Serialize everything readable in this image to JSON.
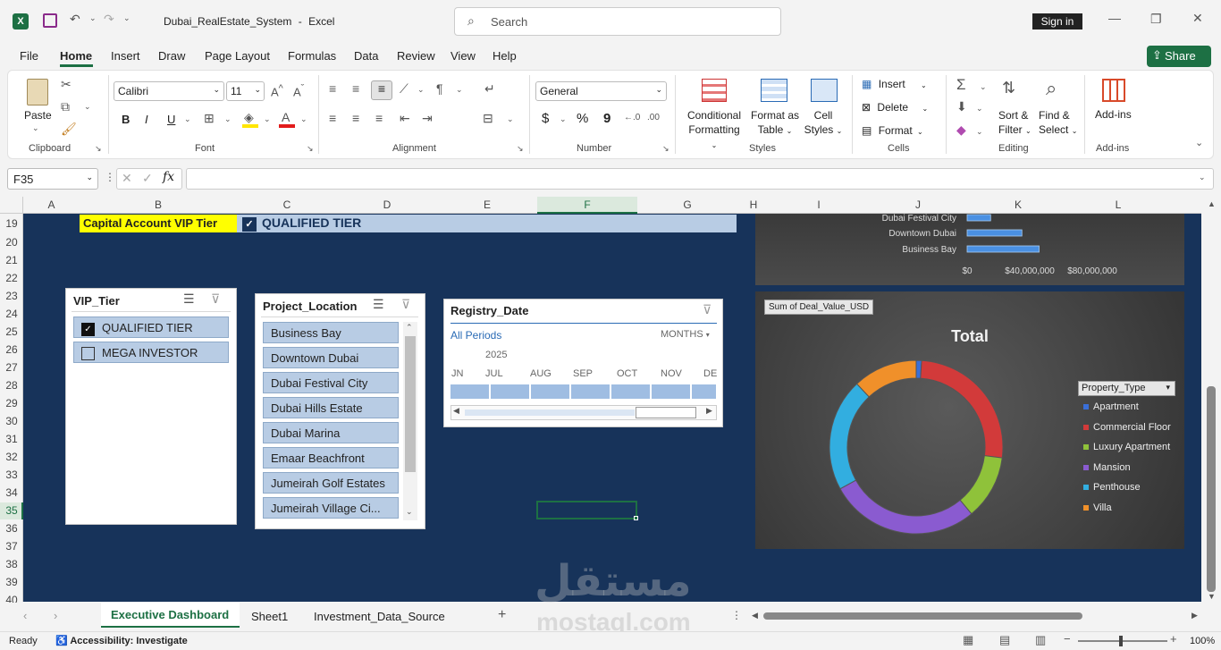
{
  "window": {
    "file_title": "Dubai_RealEstate_System",
    "app_name": "Excel",
    "title_sep": "-",
    "search_placeholder": "Search",
    "sign_in": "Sign in",
    "share": "Share"
  },
  "ribbon_tabs": [
    "File",
    "Home",
    "Insert",
    "Draw",
    "Page Layout",
    "Formulas",
    "Data",
    "Review",
    "View",
    "Help"
  ],
  "ribbon": {
    "clipboard": {
      "paste": "Paste",
      "label": "Clipboard"
    },
    "font": {
      "name": "Calibri",
      "size": "11",
      "label": "Font",
      "bold": "B",
      "italic": "I",
      "underline": "U"
    },
    "alignment": {
      "label": "Alignment"
    },
    "number": {
      "format": "General",
      "label": "Number",
      "currency": "$",
      "percent": "%",
      "comma": "9"
    },
    "styles": {
      "conditional": "Conditional",
      "formatting": "Formatting",
      "format_as": "Format as",
      "table": "Table",
      "cell": "Cell",
      "cell_styles": "Styles",
      "label": "Styles"
    },
    "cells": {
      "insert": "Insert",
      "delete": "Delete",
      "format": "Format",
      "label": "Cells"
    },
    "editing": {
      "sort": "Sort &",
      "filter": "Filter",
      "find": "Find &",
      "select": "Select",
      "label": "Editing"
    },
    "addins": {
      "addins": "Add-ins",
      "label": "Add-ins"
    }
  },
  "formula_bar": {
    "name_box": "F35",
    "fx": "fx",
    "formula": ""
  },
  "columns": [
    "A",
    "B",
    "C",
    "D",
    "E",
    "F",
    "G",
    "H",
    "I",
    "J",
    "K",
    "L"
  ],
  "rows": [
    "19",
    "20",
    "21",
    "22",
    "23",
    "24",
    "25",
    "26",
    "27",
    "28",
    "29",
    "30",
    "31",
    "32",
    "33",
    "34",
    "35",
    "36",
    "37",
    "38",
    "39",
    "40"
  ],
  "cells": {
    "b19": "Capital Account VIP Tier",
    "c19": "QUALIFIED TIER"
  },
  "slicers": {
    "vip": {
      "title": "VIP_Tier",
      "items": [
        "QUALIFIED TIER",
        "MEGA INVESTOR"
      ]
    },
    "location": {
      "title": "Project_Location",
      "items": [
        "Business Bay",
        "Downtown Dubai",
        "Dubai Festival City",
        "Dubai Hills Estate",
        "Dubai Marina",
        "Emaar Beachfront",
        "Jumeirah Golf Estates",
        "Jumeirah Village Ci..."
      ]
    },
    "timeline": {
      "title": "Registry_Date",
      "all_periods": "All Periods",
      "level": "MONTHS",
      "year": "2025",
      "months": [
        "JN",
        "JUL",
        "AUG",
        "SEP",
        "OCT",
        "NOV",
        "DE"
      ]
    }
  },
  "bar_chart": {
    "categories": [
      "Dubai Festival City",
      "Downtown Dubai",
      "Business Bay"
    ],
    "ticks": [
      "$0",
      "$40,000,000",
      "$80,000,000"
    ]
  },
  "donut_chart": {
    "field_button": "Sum of Deal_Value_USD",
    "title": "Total",
    "legend_title": "Property_Type"
  },
  "chart_data": [
    {
      "type": "bar",
      "categories": [
        "Dubai Festival City",
        "Downtown Dubai",
        "Business Bay"
      ],
      "values": [
        15000000,
        35000000,
        46000000
      ],
      "xlim": [
        0,
        80000000
      ]
    },
    {
      "type": "pie",
      "title": "Total",
      "categories": [
        "Apartment",
        "Commercial Floor",
        "Luxury Apartment",
        "Mansion",
        "Penthouse",
        "Villa"
      ],
      "values": [
        1,
        26,
        12,
        28,
        21,
        12
      ],
      "colors": [
        "#3a6fd8",
        "#d23a3a",
        "#8fc23a",
        "#8a5bd0",
        "#32aee0",
        "#f0902a"
      ]
    }
  ],
  "sheet_tabs": [
    "Executive Dashboard",
    "Sheet1",
    "Investment_Data_Source"
  ],
  "status": {
    "ready": "Ready",
    "accessibility": "Accessibility: Investigate",
    "zoom": "100%"
  },
  "watermark": {
    "arabic": "مستقل",
    "latin": "mostaql.com"
  }
}
